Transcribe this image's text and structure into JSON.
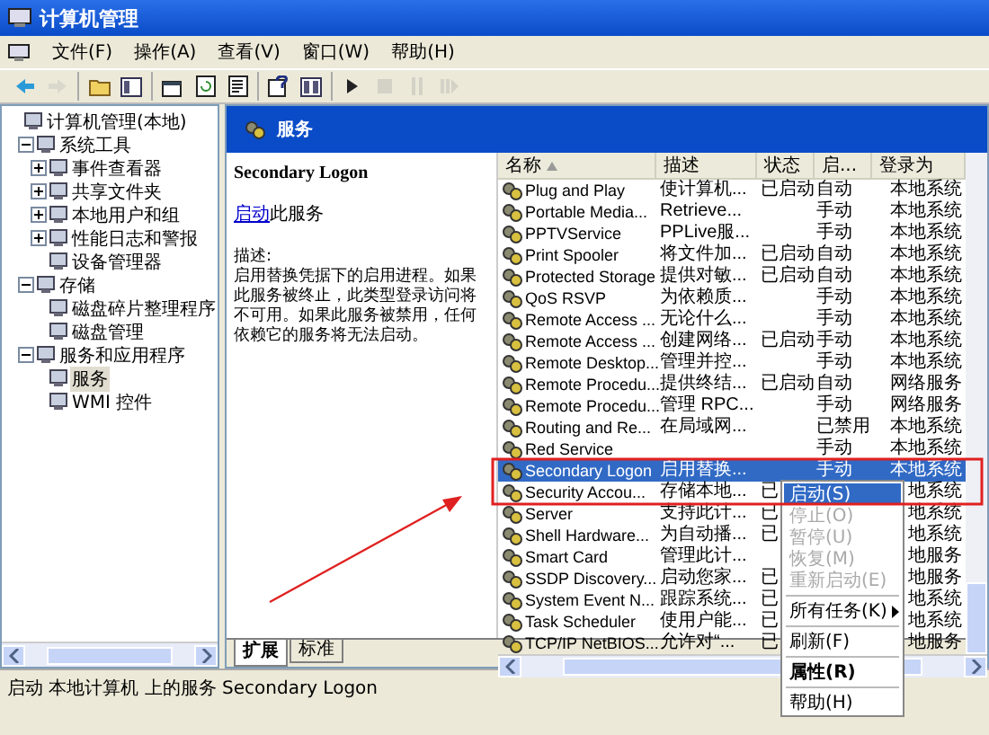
{
  "window": {
    "title": "计算机管理"
  },
  "menu_bar": [
    "文件(F)",
    "操作(A)",
    "查看(V)",
    "窗口(W)",
    "帮助(H)"
  ],
  "toolbar": [
    [
      {
        "kind": "back",
        "disabled": false
      },
      {
        "kind": "forward",
        "disabled": true
      }
    ],
    [
      {
        "kind": "up",
        "disabled": false
      },
      {
        "kind": "tree",
        "disabled": false
      }
    ],
    [
      {
        "kind": "properties",
        "disabled": false
      },
      {
        "kind": "refresh",
        "disabled": false
      },
      {
        "kind": "export",
        "disabled": false
      }
    ],
    [
      {
        "kind": "help",
        "disabled": false
      },
      {
        "kind": "view",
        "disabled": false
      }
    ],
    [
      {
        "kind": "play",
        "disabled": false
      },
      {
        "kind": "stop",
        "disabled": true
      },
      {
        "kind": "pause",
        "disabled": true
      },
      {
        "kind": "restart",
        "disabled": true
      }
    ]
  ],
  "tree": [
    {
      "label": "计算机管理(本地)",
      "selected": false,
      "children": [
        {
          "label": "系统工具",
          "selected": false,
          "expanded": true,
          "children": [
            {
              "label": "事件查看器",
              "selected": false,
              "expanded": false
            },
            {
              "label": "共享文件夹",
              "selected": false,
              "expanded": false
            },
            {
              "label": "本地用户和组",
              "selected": false,
              "expanded": false
            },
            {
              "label": "性能日志和警报",
              "selected": false,
              "expanded": false
            },
            {
              "label": "设备管理器",
              "selected": false
            }
          ]
        },
        {
          "label": "存储",
          "selected": false,
          "expanded": true,
          "children": [
            {
              "label": "磁盘碎片整理程序",
              "selected": false
            },
            {
              "label": "磁盘管理",
              "selected": false
            }
          ]
        },
        {
          "label": "服务和应用程序",
          "selected": false,
          "expanded": true,
          "children": [
            {
              "label": "服务",
              "selected": true
            },
            {
              "label": "WMI 控件",
              "selected": false
            }
          ]
        }
      ]
    }
  ],
  "pane_header": {
    "title": "服务"
  },
  "details": {
    "service_name": "Secondary Logon",
    "action_link": "启动",
    "action_text": "此服务",
    "description_label": "描述:",
    "description": "启用替换凭据下的启用进程。如果此服务被终止，此类型登录访问将不可用。如果此服务被禁用，任何依赖它的服务将无法启动。"
  },
  "columns": [
    {
      "label": "名称",
      "sorted": true
    },
    {
      "label": "描述",
      "sorted": false
    },
    {
      "label": "状态",
      "sorted": false
    },
    {
      "label": "启...",
      "sorted": false
    },
    {
      "label": "登录为",
      "sorted": false
    }
  ],
  "services": [
    {
      "name": "Plug and Play",
      "description": "使计算机...",
      "status": "已启动",
      "startup": "自动",
      "logon": "本地系统",
      "selected": false
    },
    {
      "name": "Portable Media...",
      "description": "Retrieve...",
      "startup": "手动",
      "logon": "本地系统",
      "selected": false
    },
    {
      "name": "PPTVService",
      "description": "PPLive服...",
      "startup": "手动",
      "logon": "本地系统",
      "selected": false
    },
    {
      "name": "Print Spooler",
      "description": "将文件加...",
      "status": "已启动",
      "startup": "自动",
      "logon": "本地系统",
      "selected": false
    },
    {
      "name": "Protected Storage",
      "description": "提供对敏...",
      "status": "已启动",
      "startup": "自动",
      "logon": "本地系统",
      "selected": false
    },
    {
      "name": "QoS RSVP",
      "description": "为依赖质...",
      "startup": "手动",
      "logon": "本地系统",
      "selected": false
    },
    {
      "name": "Remote Access ...",
      "description": "无论什么...",
      "startup": "手动",
      "logon": "本地系统",
      "selected": false
    },
    {
      "name": "Remote Access ...",
      "description": "创建网络...",
      "status": "已启动",
      "startup": "手动",
      "logon": "本地系统",
      "selected": false
    },
    {
      "name": "Remote Desktop...",
      "description": "管理并控...",
      "startup": "手动",
      "logon": "本地系统",
      "selected": false
    },
    {
      "name": "Remote Procedu...",
      "description": "提供终结...",
      "status": "已启动",
      "startup": "自动",
      "logon": "网络服务",
      "selected": false
    },
    {
      "name": "Remote Procedu...",
      "description": "管理 RPC...",
      "startup": "手动",
      "logon": "网络服务",
      "selected": false
    },
    {
      "name": "Routing and Re...",
      "description": "在局域网...",
      "startup": "已禁用",
      "logon": "本地系统",
      "selected": false
    },
    {
      "name": "Red Service",
      "startup": "手动",
      "logon": "本地系统",
      "selected": false
    },
    {
      "name": "Secondary Logon",
      "description": "启用替换...",
      "startup": "手动",
      "logon": "本地系统",
      "selected": true
    },
    {
      "name": "Security Accou...",
      "description": "存储本地...",
      "status": "已",
      "logon": "地系统",
      "selected": false
    },
    {
      "name": "Server",
      "description": "支持此计...",
      "status": "已",
      "logon": "地系统",
      "selected": false
    },
    {
      "name": "Shell Hardware...",
      "description": "为自动播...",
      "status": "已",
      "logon": "地系统",
      "selected": false
    },
    {
      "name": "Smart Card",
      "description": "管理此计...",
      "logon": "地服务",
      "selected": false
    },
    {
      "name": "SSDP Discovery...",
      "description": "启动您家...",
      "status": "已",
      "logon": "地服务",
      "selected": false
    },
    {
      "name": "System Event N...",
      "description": "跟踪系统...",
      "status": "已",
      "logon": "地系统",
      "selected": false
    },
    {
      "name": "Task Scheduler",
      "description": "使用户能...",
      "status": "已",
      "logon": "地系统",
      "selected": false
    },
    {
      "name": "TCP/IP NetBIOS...",
      "description": "允许对“...",
      "status": "已",
      "logon": "地服务",
      "selected": false
    }
  ],
  "context_menu": [
    {
      "kind": "item",
      "label": "启动(S)",
      "selected": true,
      "disabled": false,
      "bold": false
    },
    {
      "kind": "item",
      "label": "停止(O)",
      "selected": false,
      "disabled": true,
      "bold": false
    },
    {
      "kind": "item",
      "label": "暂停(U)",
      "selected": false,
      "disabled": true,
      "bold": false
    },
    {
      "kind": "item",
      "label": "恢复(M)",
      "selected": false,
      "disabled": true,
      "bold": false
    },
    {
      "kind": "item",
      "label": "重新启动(E)",
      "selected": false,
      "disabled": true,
      "bold": false
    },
    {
      "kind": "separator"
    },
    {
      "kind": "submenu",
      "label": "所有任务(K)",
      "selected": false,
      "disabled": false,
      "bold": false
    },
    {
      "kind": "separator"
    },
    {
      "kind": "item",
      "label": "刷新(F)",
      "selected": false,
      "disabled": false,
      "bold": false
    },
    {
      "kind": "separator"
    },
    {
      "kind": "item",
      "label": "属性(R)",
      "selected": false,
      "disabled": false,
      "bold": true
    },
    {
      "kind": "separator"
    },
    {
      "kind": "item",
      "label": "帮助(H)",
      "selected": false,
      "disabled": false,
      "bold": false
    }
  ],
  "tabs": [
    {
      "label": "扩展",
      "selected": true
    },
    {
      "label": "标准",
      "selected": false
    }
  ],
  "status_bar": "启动 本地计算机 上的服务 Secondary Logon"
}
